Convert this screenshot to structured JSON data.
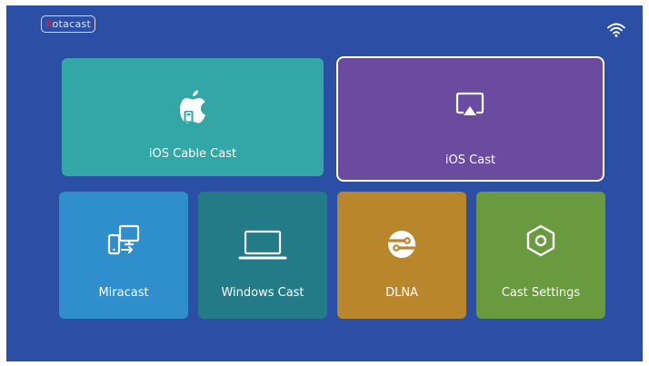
{
  "brand": {
    "logo_first": "R",
    "logo_rest": "otacast"
  },
  "status": {
    "wifi_icon": "wifi-icon"
  },
  "tiles": {
    "ios_cable_cast": {
      "label": "iOS Cable Cast",
      "icon": "apple-cable-icon",
      "color": "#32a7a5"
    },
    "ios_cast": {
      "label": "iOS Cast",
      "icon": "airplay-icon",
      "color": "#6a4ba0",
      "selected": true
    },
    "miracast": {
      "label": "Miracast",
      "icon": "devices-icon",
      "color": "#2f8fcd"
    },
    "windows_cast": {
      "label": "Windows Cast",
      "icon": "laptop-icon",
      "color": "#227b86"
    },
    "dlna": {
      "label": "DLNA",
      "icon": "dlna-icon",
      "color": "#b9862c"
    },
    "cast_settings": {
      "label": "Cast Settings",
      "icon": "hexagon-settings-icon",
      "color": "#6a9a3e"
    }
  }
}
